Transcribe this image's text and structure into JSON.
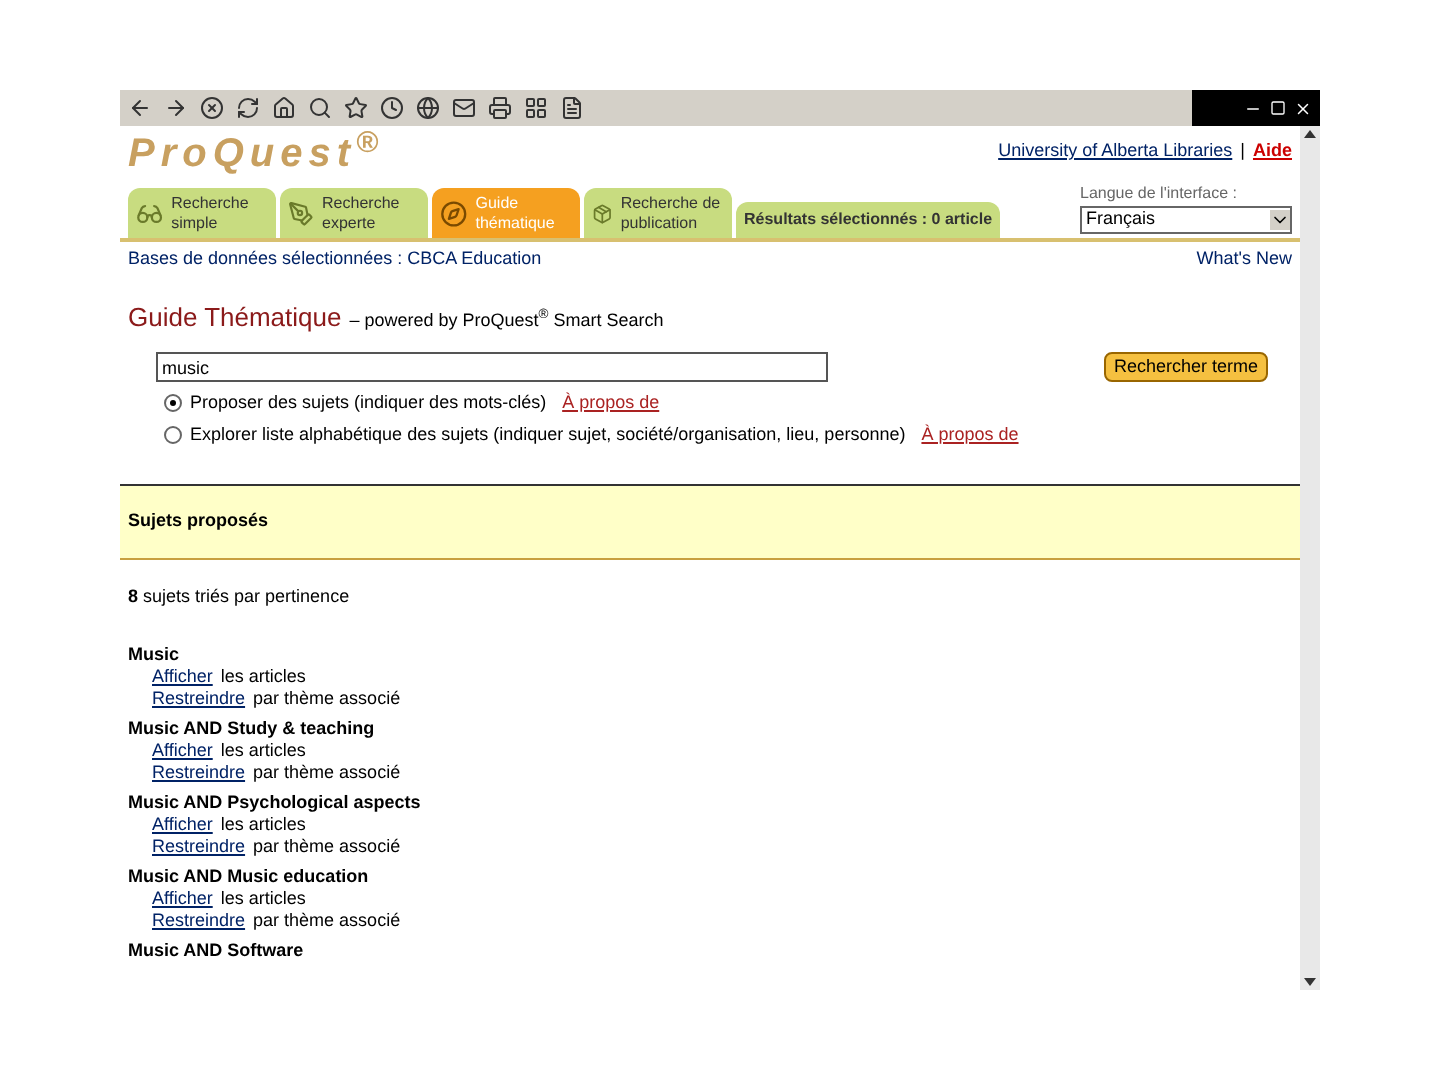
{
  "logo": "ProQuest$^{®}$",
  "header": {
    "institution_link": "University of Alberta Libraries",
    "separator": "|",
    "help_link": "Aide"
  },
  "tabs": [
    {
      "label": "Recherche simple",
      "kind": "search",
      "selected": false
    },
    {
      "label": "Recherche experte",
      "kind": "expert",
      "selected": false
    },
    {
      "label": "Guide thématique",
      "kind": "guide",
      "selected": true
    },
    {
      "label": "Recherche de publication",
      "kind": "publication",
      "selected": false
    },
    {
      "label": "Résultats sélectionnés : 0 article",
      "kind": "results",
      "selected": false
    }
  ],
  "language": {
    "label": "Langue de l'interface :",
    "value": "Français"
  },
  "databases": "Bases de données sélectionnées : CBCA Education",
  "whats_new": "What's New",
  "title": "Guide Thématique",
  "subtitle": "– powered by ProQuest$^{®}$ Smart Search",
  "search": {
    "value": "music",
    "button": "Rechercher terme"
  },
  "options": [
    {
      "label": "Proposer des sujets (indiquer des mots-clés)",
      "link": "À propos de",
      "selected": true
    },
    {
      "label": "Explorer liste alphabétique des sujets (indiquer sujet, société/organisation, lieu, personne)",
      "link": "À propos de",
      "selected": false
    }
  ],
  "panel_title": "Sujets proposés",
  "count": "**8** sujets triés par pertinence",
  "subjects": [
    {
      "title": "Music",
      "show_link": "Afficher",
      "show_text": "les articles",
      "narrow_link": "Restreindre",
      "narrow_text": "par thème associé"
    },
    {
      "title": "Music AND Study & teaching",
      "show_link": "Afficher",
      "show_text": "les articles",
      "narrow_link": "Restreindre",
      "narrow_text": "par thème associé"
    },
    {
      "title": "Music AND Psychological aspects",
      "show_link": "Afficher",
      "show_text": "les articles",
      "narrow_link": "Restreindre",
      "narrow_text": "par thème associé"
    },
    {
      "title": "Music AND Music education",
      "show_link": "Afficher",
      "show_text": "les articles",
      "narrow_link": "Restreindre",
      "narrow_text": "par thème associé"
    },
    {
      "title": "Music AND Software"
    }
  ]
}
